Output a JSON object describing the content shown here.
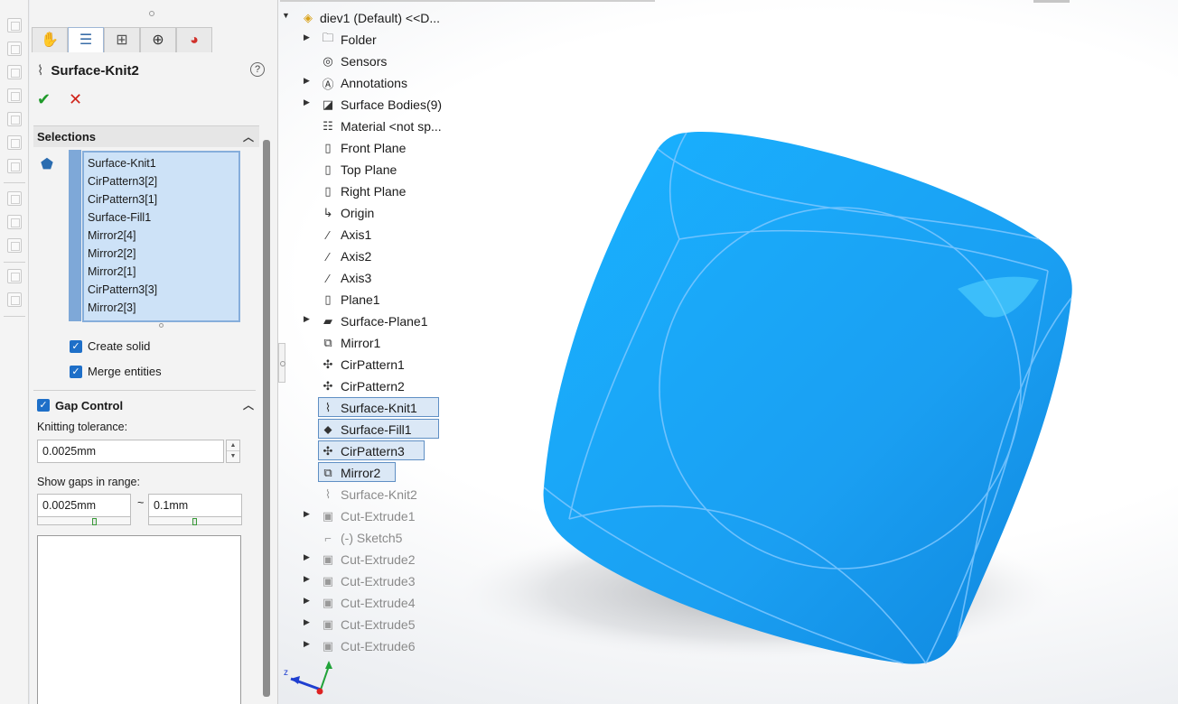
{
  "property_manager": {
    "title": "Surface-Knit2",
    "help": "?",
    "ok": "✔",
    "cancel": "✕",
    "tabs": [
      "feature-manager",
      "property-manager",
      "configuration-manager",
      "dimxpert-manager",
      "display-manager"
    ],
    "selections": {
      "header": "Selections",
      "items": [
        "Surface-Knit1",
        "CirPattern3[2]",
        "CirPattern3[1]",
        "Surface-Fill1",
        "Mirror2[4]",
        "Mirror2[2]",
        "Mirror2[1]",
        "CirPattern3[3]",
        "Mirror2[3]"
      ]
    },
    "create_solid": {
      "label": "Create solid",
      "checked": true
    },
    "merge_entities": {
      "label": "Merge entities",
      "checked": true
    },
    "gap_control": {
      "header": "Gap Control",
      "checked": true,
      "knitting_tolerance_label": "Knitting tolerance:",
      "knitting_tolerance_value": "0.0025mm",
      "show_gaps_label": "Show gaps in range:",
      "range_min": "0.0025mm",
      "range_sep": "~",
      "range_max": "0.1mm"
    }
  },
  "tree": {
    "root": "diev1 (Default) <<D...",
    "items": [
      {
        "label": "Folder",
        "icon": "folder-icon",
        "expand": true,
        "state": "normal"
      },
      {
        "label": "Sensors",
        "icon": "sensors-icon",
        "expand": false,
        "state": "normal"
      },
      {
        "label": "Annotations",
        "icon": "annotations-icon",
        "expand": true,
        "state": "normal"
      },
      {
        "label": "Surface Bodies(9)",
        "icon": "surface-bodies-icon",
        "expand": true,
        "state": "normal"
      },
      {
        "label": "Material <not sp...",
        "icon": "material-icon",
        "expand": false,
        "state": "normal"
      },
      {
        "label": "Front Plane",
        "icon": "plane-icon",
        "expand": false,
        "state": "normal"
      },
      {
        "label": "Top Plane",
        "icon": "plane-icon",
        "expand": false,
        "state": "normal"
      },
      {
        "label": "Right Plane",
        "icon": "plane-icon",
        "expand": false,
        "state": "normal"
      },
      {
        "label": "Origin",
        "icon": "origin-icon",
        "expand": false,
        "state": "normal"
      },
      {
        "label": "Axis1",
        "icon": "axis-icon",
        "expand": false,
        "state": "normal"
      },
      {
        "label": "Axis2",
        "icon": "axis-icon",
        "expand": false,
        "state": "normal"
      },
      {
        "label": "Axis3",
        "icon": "axis-icon",
        "expand": false,
        "state": "normal"
      },
      {
        "label": "Plane1",
        "icon": "plane-icon",
        "expand": false,
        "state": "normal"
      },
      {
        "label": "Surface-Plane1",
        "icon": "surface-plane-icon",
        "expand": true,
        "state": "normal"
      },
      {
        "label": "Mirror1",
        "icon": "mirror-icon",
        "expand": false,
        "state": "normal"
      },
      {
        "label": "CirPattern1",
        "icon": "cirpattern-icon",
        "expand": false,
        "state": "normal"
      },
      {
        "label": "CirPattern2",
        "icon": "cirpattern-icon",
        "expand": false,
        "state": "normal"
      },
      {
        "label": "Surface-Knit1",
        "icon": "surface-knit-icon",
        "expand": false,
        "state": "selected"
      },
      {
        "label": "Surface-Fill1",
        "icon": "surface-fill-icon",
        "expand": false,
        "state": "selected"
      },
      {
        "label": "CirPattern3",
        "icon": "cirpattern-icon",
        "expand": false,
        "state": "selected"
      },
      {
        "label": "Mirror2",
        "icon": "mirror-icon",
        "expand": false,
        "state": "selected"
      },
      {
        "label": "Surface-Knit2",
        "icon": "surface-knit-icon",
        "expand": false,
        "state": "dim"
      },
      {
        "label": "Cut-Extrude1",
        "icon": "cut-extrude-icon",
        "expand": true,
        "state": "dim"
      },
      {
        "label": "(-) Sketch5",
        "icon": "sketch-icon",
        "expand": false,
        "state": "dim"
      },
      {
        "label": "Cut-Extrude2",
        "icon": "cut-extrude-icon",
        "expand": true,
        "state": "dim"
      },
      {
        "label": "Cut-Extrude3",
        "icon": "cut-extrude-icon",
        "expand": true,
        "state": "dim"
      },
      {
        "label": "Cut-Extrude4",
        "icon": "cut-extrude-icon",
        "expand": true,
        "state": "dim"
      },
      {
        "label": "Cut-Extrude5",
        "icon": "cut-extrude-icon",
        "expand": true,
        "state": "dim"
      },
      {
        "label": "Cut-Extrude6",
        "icon": "cut-extrude-icon",
        "expand": true,
        "state": "dim"
      }
    ]
  },
  "viewport": {
    "model_color": "#1aa3f5",
    "triad_z_label": "z"
  }
}
